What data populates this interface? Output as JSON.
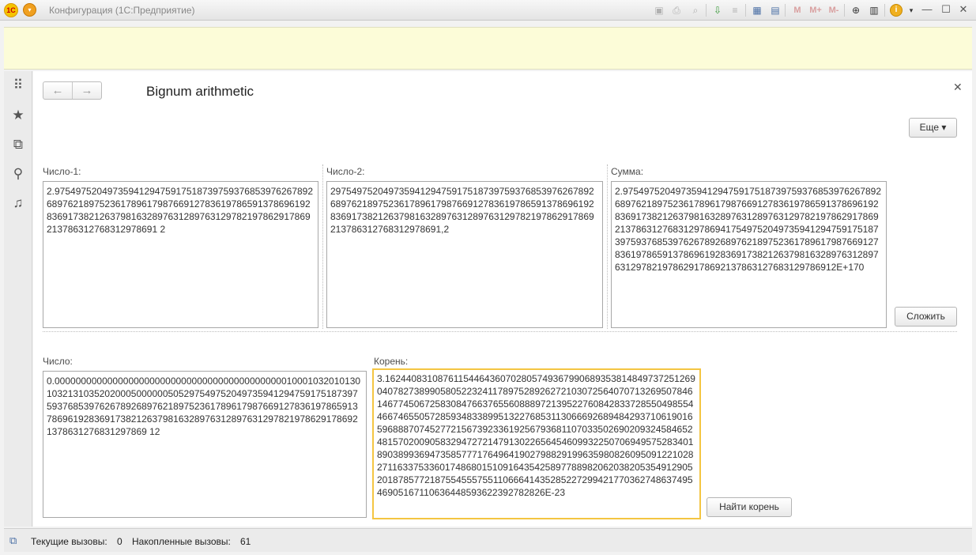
{
  "window": {
    "title": "Конфигурация  (1С:Предприятие)",
    "logo": "1С"
  },
  "toolbar": {
    "m_label": "M",
    "mplus_label": "M+",
    "mminus_label": "M-"
  },
  "form": {
    "title": "Bignum arithmetic",
    "more_button": "Еще",
    "add_button": "Сложить",
    "root_button": "Найти корень"
  },
  "fields": {
    "number1_label": "Число-1:",
    "number1_value": "2.97549752049735941294759175187397593768539762678926897621897523617896179876691278361978659137869619283691738212637981632897631289763129782197862917869213786312768312978691 2",
    "number2_label": "Число-2:",
    "number2_value": "297549752049735941294759175187397593768539762678926897621897523617896179876691278361978659137869619283691738212637981632897631289763129782197862917869213786312768312978691,2",
    "sum_label": "Сумма:",
    "sum_value": "2.97549752049735941294759175187397593768539762678926897621897523617896179876691278361978659137869619283691738212637981632897631289763129782197862917869213786312768312978694175497520497359412947591751873975937685397626789268976218975236178961798766912783619786591378696192836917382126379816328976312897631297821978629178692137863127683129786912E+170",
    "number_label": "Число:",
    "number_value": "0.00000000000000000000000000000000000000000000100010320101301032131035202000500000050529754975204973594129475917518739759376853976267892689762189752361789617987669127836197865913786961928369173821263798163289763128976312978219786291786921378631276831297869 12",
    "root_label": "Корень:",
    "root_value": "3.1624408310876115446436070280574936799068935381484973725126904078273899058052232411789752892627210307256407071326950784614677450672583084766376556088897213952276084283372855049855446674655057285934833899513227685311306669268948429371061901659688870745277215673923361925679368110703350269020932458465248157020090583294727214791302265645460993225070694957528340189038993694735857771764964190279882919963598082609509122102827116337533601748680151091643542589778898206203820535491290520187857721875545557551106664143528522729942177036274863749546905167110636448593622392782826E-23"
  },
  "status": {
    "current_calls_label": "Текущие вызовы:",
    "current_calls_value": "0",
    "accumulated_calls_label": "Накопленные вызовы:",
    "accumulated_calls_value": "61"
  }
}
